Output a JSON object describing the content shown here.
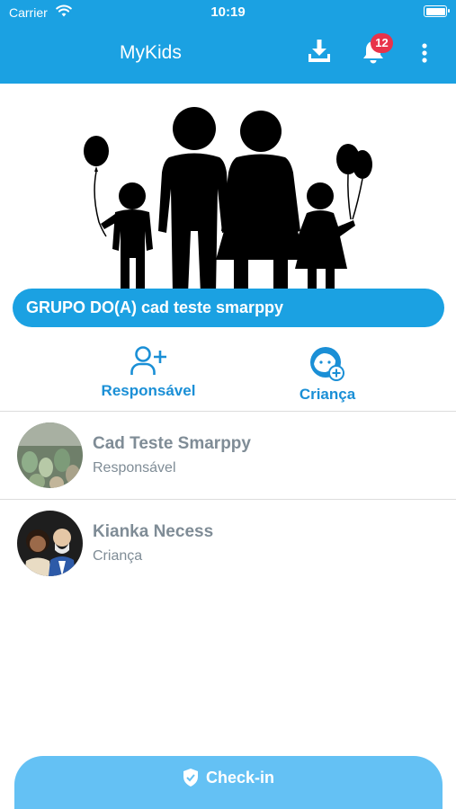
{
  "status_bar": {
    "carrier": "Carrier",
    "time": "10:19"
  },
  "header": {
    "title": "MyKids",
    "notification_count": "12",
    "icons": [
      "download-icon",
      "bell-icon",
      "more-vertical-icon"
    ]
  },
  "group": {
    "title": "GRUPO DO(A) cad teste smarppy"
  },
  "actions": [
    {
      "label": "Responsável",
      "icon": "add-person-icon"
    },
    {
      "label": "Criança",
      "icon": "add-child-icon"
    }
  ],
  "members": [
    {
      "name": "Cad Teste Smarppy",
      "role": "Responsável"
    },
    {
      "name": "Kianka Necess",
      "role": "Criança"
    }
  ],
  "checkin": {
    "label": "Check-in",
    "icon": "shield-check-icon"
  },
  "colors": {
    "primary": "#1ba1e2",
    "accent_text": "#1a8fd6",
    "badge": "#e8334a",
    "checkin": "#64c1f4",
    "muted_text": "#7f8c96"
  }
}
